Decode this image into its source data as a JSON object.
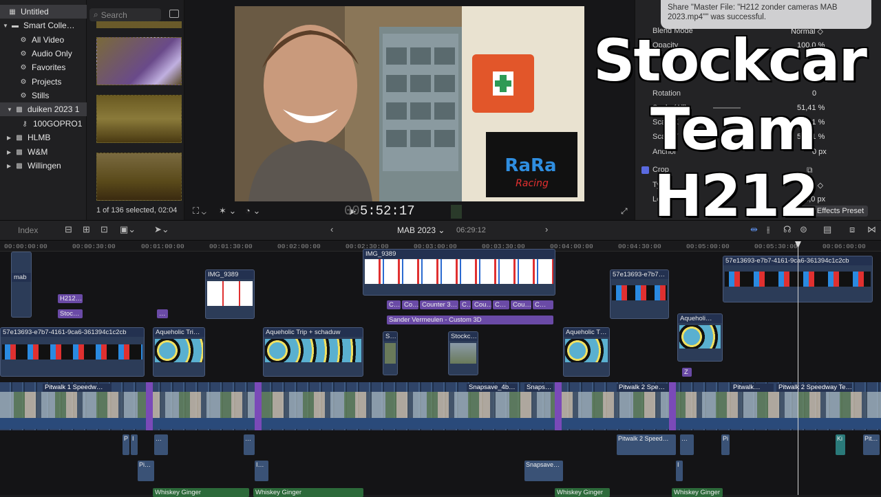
{
  "library": {
    "items": [
      {
        "label": "Untitled",
        "icon": "library-icon"
      },
      {
        "label": "Smart Colle…",
        "icon": "folder-icon"
      },
      {
        "label": "All Video",
        "icon": "gear-icon"
      },
      {
        "label": "Audio Only",
        "icon": "gear-icon"
      },
      {
        "label": "Favorites",
        "icon": "gear-icon"
      },
      {
        "label": "Projects",
        "icon": "gear-icon"
      },
      {
        "label": "Stills",
        "icon": "gear-icon"
      },
      {
        "label": "duiken 2023 1",
        "icon": "event-icon"
      },
      {
        "label": "100GOPRO1",
        "icon": "keyword-icon"
      },
      {
        "label": "HLMB",
        "icon": "event-icon"
      },
      {
        "label": "W&M",
        "icon": "event-icon"
      },
      {
        "label": "Willingen",
        "icon": "event-icon"
      }
    ]
  },
  "browser": {
    "search_placeholder": "Search",
    "selection_status": "1 of 136 selected, 02:04"
  },
  "viewer": {
    "timecode_dim": "00",
    "timecode": "5:52:17"
  },
  "notification": {
    "text": "Share \"Master File: \"H212 zonder cameras MAB 2023.mp4\"\" was successful."
  },
  "inspector": {
    "rows": [
      {
        "label": "Blend Mode",
        "value": "Normal ◇"
      },
      {
        "label": "Opacity",
        "value": "100,0 %"
      },
      {
        "label": "Rotation",
        "value": "0"
      },
      {
        "label": "Scale (All)",
        "value": "51,41 %"
      },
      {
        "label": "Scale X",
        "value": "51,41 %"
      },
      {
        "label": "Scale Y",
        "value": "51,41 %"
      },
      {
        "label": "Anchor",
        "value": "0 px"
      },
      {
        "label": "Crop",
        "value": ""
      },
      {
        "label": "Type",
        "value": "Trim ◇"
      },
      {
        "label": "Left",
        "value": "40,0 px"
      }
    ],
    "save_preset": "Save Effects Preset"
  },
  "overlay": {
    "line1": "Stockcar",
    "line2": "Team",
    "line3": "H212"
  },
  "timeline": {
    "index_label": "Index",
    "project_name": "MAB 2023 ⌄",
    "duration": "06:29:12",
    "ruler": [
      "00:00:00:00",
      "00:00:30:00",
      "00:01:00:00",
      "00:01:30:00",
      "00:02:00:00",
      "00:02:30:00",
      "00:03:00:00",
      "00:03:30:00",
      "00:04:00:00",
      "00:04:30:00",
      "00:05:00:00",
      "00:05:30:00",
      "00:06:00:00"
    ],
    "upper_clips": [
      {
        "label": "mab"
      },
      {
        "label": "IMG_9389"
      },
      {
        "label": "IMG_9389"
      },
      {
        "label": "57e13693-e7b7…"
      },
      {
        "label": "57e13693-e7b7-4161-9ca6-361394c1c2cb"
      }
    ],
    "titles": [
      "H212…",
      "Stoc…",
      "…",
      "C…",
      "Co…",
      "Counter 3…",
      "C…",
      "Cou…",
      "C…",
      "Cou…",
      "C…",
      "Sander Vermeulen - Custom 3D",
      "Z"
    ],
    "mid_clips": [
      {
        "label": "57e13693-e7b7-4161-9ca6-361394c1c2cb"
      },
      {
        "label": "Aqueholic Tri…"
      },
      {
        "label": "Aqueholic Trip + schaduw"
      },
      {
        "label": "S…"
      },
      {
        "label": "Stockc…"
      },
      {
        "label": "Aqueholic T…"
      },
      {
        "label": "Aqueholi…"
      }
    ],
    "primary_clips": [
      {
        "label": "Pitwalk 1 Speedw…"
      },
      {
        "label": "Snapsave_4b…"
      },
      {
        "label": "Snaps…"
      },
      {
        "label": "Pitwalk 2 Spe…"
      },
      {
        "label": "Pitwalk…"
      },
      {
        "label": "Pitwalk 2 Speedway Te…"
      }
    ],
    "connected_below": [
      "P",
      "I",
      "…",
      "…",
      "Pitwalk 2 Speed…",
      "…",
      "Pi",
      "Ki",
      "Pit…",
      "Pi…",
      "I…",
      "Snapsave…",
      "I"
    ],
    "audio_clips": [
      "Whiskey Ginger",
      "Whiskey Ginger",
      "Whiskey Ginger",
      "Whiskey Ginger",
      "Whiskey Ginger"
    ]
  },
  "colors": {
    "accent": "#6a4aa6",
    "clip": "#2c3c58",
    "audio": "#2c6a3a"
  }
}
